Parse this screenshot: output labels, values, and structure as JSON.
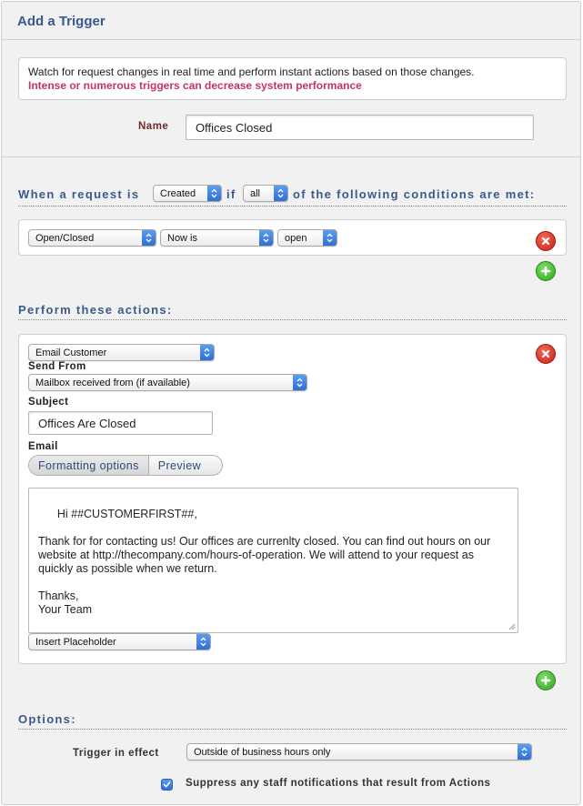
{
  "header": {
    "title": "Add a Trigger"
  },
  "info": {
    "description": "Watch for request changes in real time and perform instant actions based on those changes.",
    "warning": "Intense or numerous triggers can decrease system performance"
  },
  "name_field": {
    "label": "Name",
    "value": "Offices Closed"
  },
  "conditions": {
    "prefix": "When a request is",
    "event_value": "Created",
    "if_word": "if",
    "match_value": "all",
    "suffix": "of the following conditions are met:",
    "rows": [
      {
        "field": "Open/Closed",
        "operator": "Now is",
        "value": "open"
      }
    ]
  },
  "actions": {
    "title": "Perform these actions:",
    "action_type": "Email Customer",
    "send_from_label": "Send From",
    "send_from_value": "Mailbox received from (if available)",
    "subject_label": "Subject",
    "subject_value": "Offices Are Closed",
    "email_label": "Email",
    "formatting_label": "Formatting options",
    "preview_label": "Preview",
    "email_body": "Hi ##CUSTOMERFIRST##,\n\nThank for for contacting us! Our offices are currenlty closed. You can find out hours on our website at http://thecompany.com/hours-of-operation. We will attend to your request as quickly as possible when we return.\n\nThanks,\nYour Team",
    "placeholder_select": "Insert Placeholder"
  },
  "options": {
    "title": "Options:",
    "trigger_label": "Trigger in effect",
    "trigger_value": "Outside of business hours only",
    "suppress_label": "Suppress any staff notifications that result from Actions",
    "suppress_checked": true
  },
  "colors": {
    "title_blue": "#3a5a8c",
    "warning_pink": "#c3356a",
    "select_blue": "#2f6fd6",
    "delete_red": "#c81e14",
    "add_green": "#2fa61d"
  },
  "icons": {
    "delete": "delete-circle-icon",
    "add": "add-circle-icon",
    "select_arrow": "updown-chevron-icon",
    "checkbox": "checkmark-icon"
  }
}
